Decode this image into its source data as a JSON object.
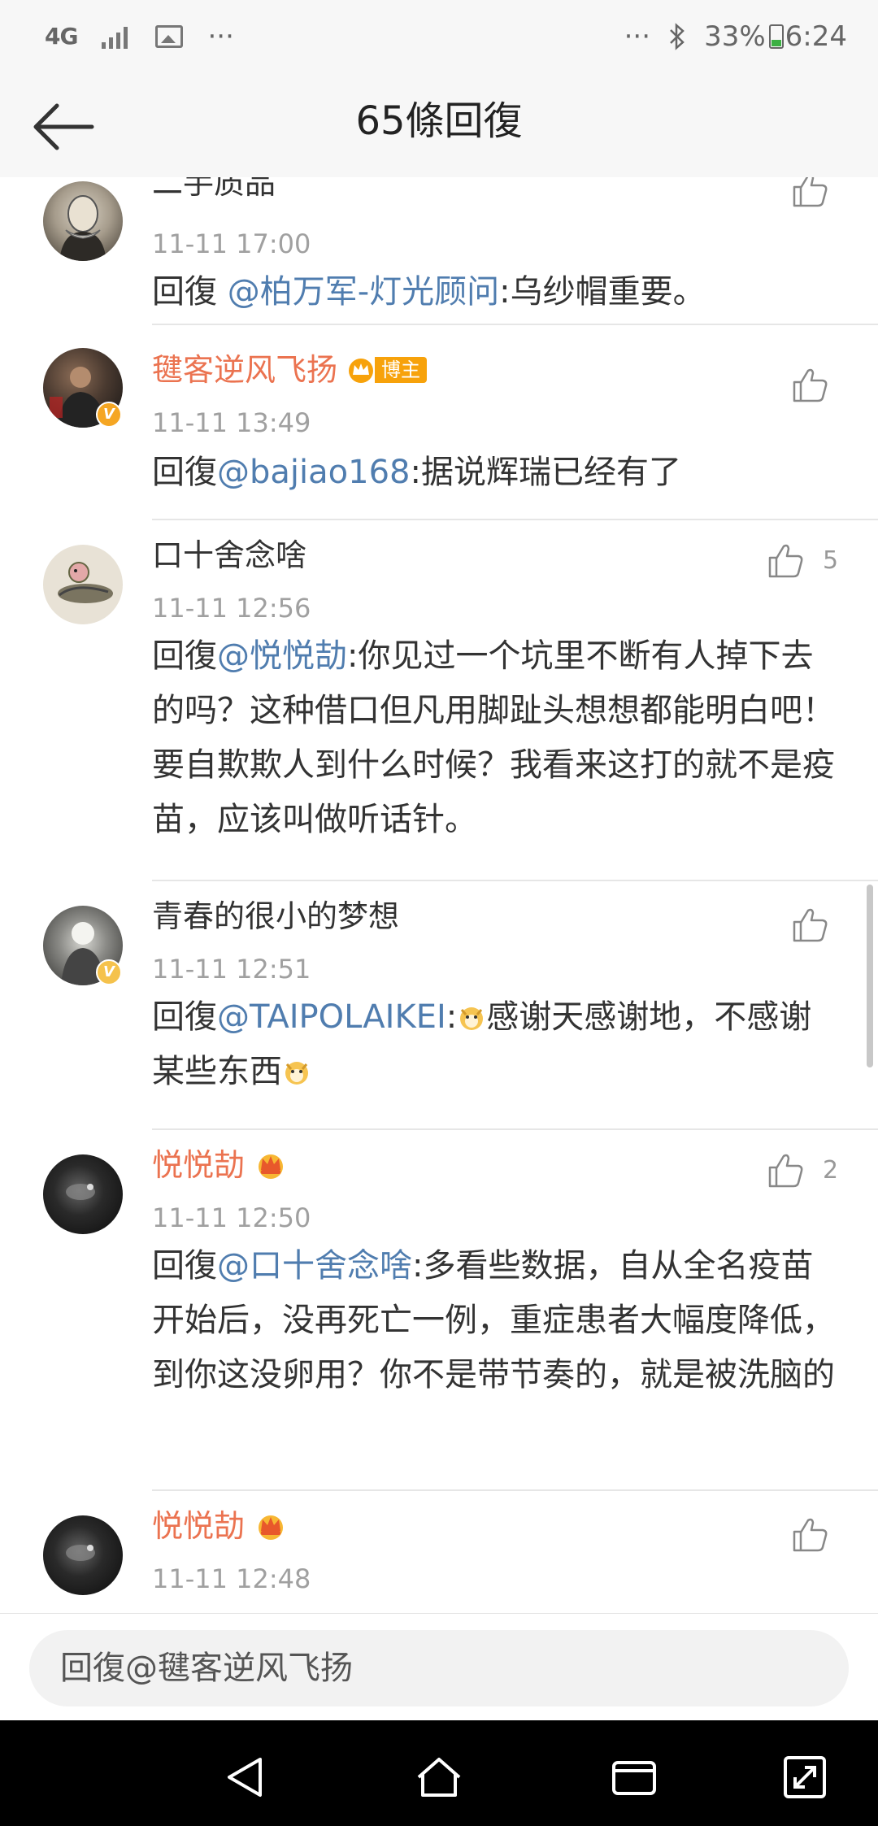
{
  "status_bar": {
    "network": "4G",
    "more_left": "···",
    "more_right": "···",
    "battery": "33%",
    "time": "6:24"
  },
  "nav": {
    "title": "65條回復"
  },
  "comments": [
    {
      "username": "二手质品",
      "time": "11-11 17:00",
      "reply_prefix": "回復 ",
      "mention": "@柏万军-灯光顾问",
      "text": ":乌纱帽重要。"
    },
    {
      "username": "毽客逆风飞扬",
      "badge": "博主",
      "time": "11-11 13:49",
      "reply_prefix": "回復",
      "mention": "@bajiao168",
      "text": ":据说辉瑞已经有了"
    },
    {
      "username": "口十舍念啥",
      "likes": "5",
      "time": "11-11 12:56",
      "reply_prefix": "回復",
      "mention": "@悦悦劼",
      "text": ":你见过一个坑里不断有人掉下去的吗？这种借口但凡用脚趾头想想都能明白吧！要自欺欺人到什么时候？我看来这打的就不是疫苗，应该叫做听话针。"
    },
    {
      "username": "青春的很小的梦想",
      "time": "11-11 12:51",
      "reply_prefix": "回復",
      "mention": "@TAIPOLAIKEI",
      "text_a": ":",
      "text_b": "感谢天感谢地，不感谢某些东西"
    },
    {
      "username": "悦悦劼",
      "likes": "2",
      "time": "11-11 12:50",
      "reply_prefix": "回復",
      "mention": "@口十舍念啥",
      "text": ":多看些数据，自从全名疫苗开始后，没再死亡一例，重症患者大幅度降低，到你这没卵用？你不是带节奏的，就是被洗脑的"
    },
    {
      "username": "悦悦劼",
      "time": "11-11 12:48"
    }
  ],
  "reply_input": {
    "placeholder": "回復@毽客逆风飞扬"
  },
  "colors": {
    "accent_orange": "#eb7350",
    "mention_blue": "#507daf",
    "time_gray": "#a0a0a0"
  },
  "icons": [
    "back-arrow-icon",
    "thumb-up-icon",
    "crown-icon",
    "verified-icon",
    "dog-emoji-icon",
    "nav-back-icon",
    "nav-home-icon",
    "nav-recents-icon",
    "nav-expand-icon"
  ]
}
